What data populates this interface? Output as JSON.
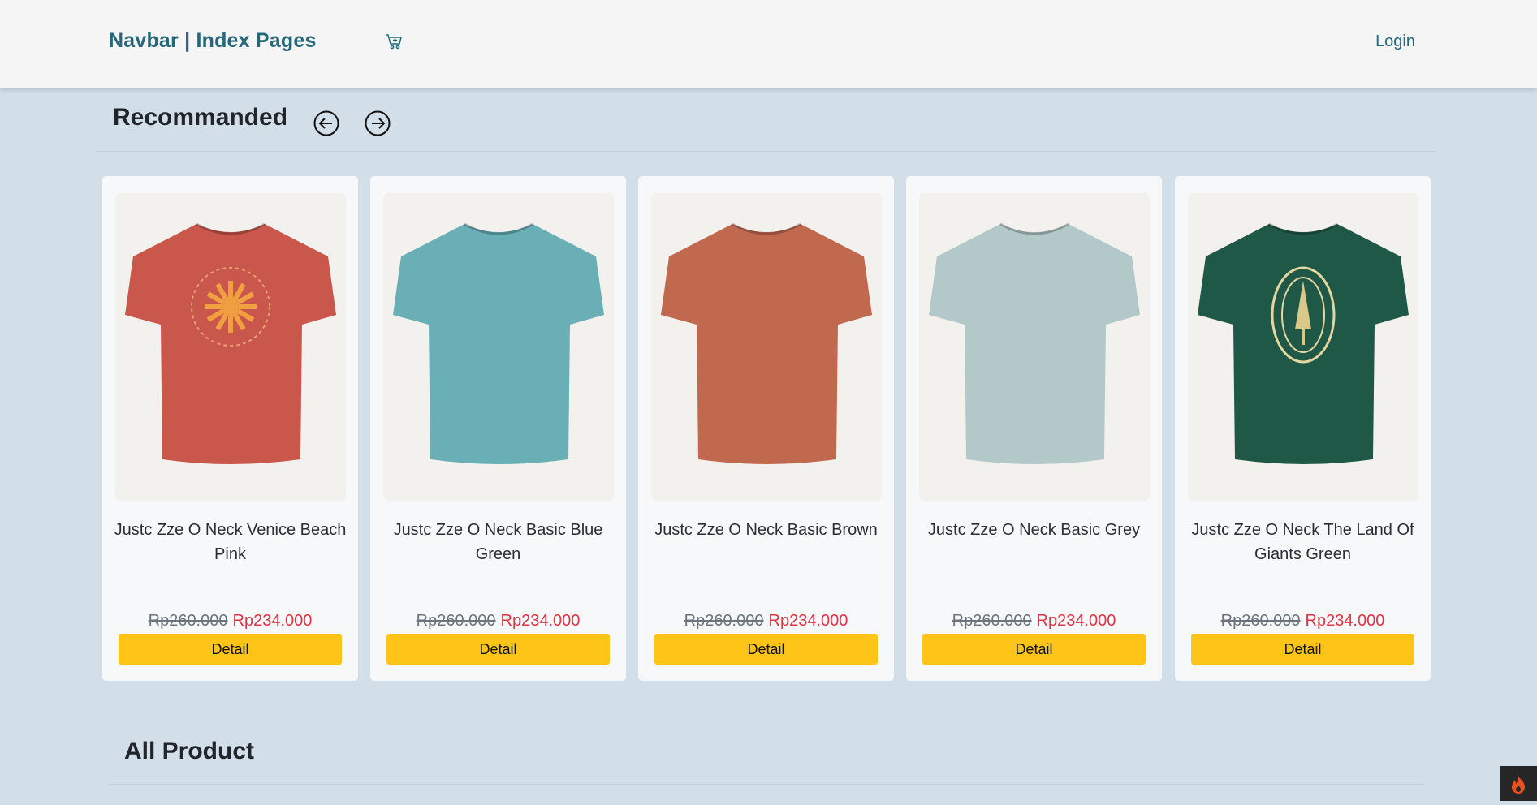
{
  "navbar": {
    "brand": "Navbar | Index Pages",
    "cart_icon": "cart-plus-icon",
    "login": "Login"
  },
  "recommended": {
    "title": "Recommanded",
    "prev_icon": "arrow-left-circle-icon",
    "next_icon": "arrow-right-circle-icon"
  },
  "products": [
    {
      "name": "Justc Zze O Neck Venice Beach Pink",
      "old_price": "Rp260.000",
      "price": "Rp234.000",
      "button": "Detail",
      "color": "#c9574b",
      "print": "sun"
    },
    {
      "name": "Justc Zze O Neck Basic Blue Green",
      "old_price": "Rp260.000",
      "price": "Rp234.000",
      "button": "Detail",
      "color": "#6aaeb6",
      "print": "none"
    },
    {
      "name": "Justc Zze O Neck Basic Brown",
      "old_price": "Rp260.000",
      "price": "Rp234.000",
      "button": "Detail",
      "color": "#c0694f",
      "print": "none"
    },
    {
      "name": "Justc Zze O Neck Basic Grey",
      "old_price": "Rp260.000",
      "price": "Rp234.000",
      "button": "Detail",
      "color": "#b3c8c8",
      "print": "none"
    },
    {
      "name": "Justc Zze O Neck The Land Of Giants Green",
      "old_price": "Rp260.000",
      "price": "Rp234.000",
      "button": "Detail",
      "color": "#1f5846",
      "print": "badge"
    }
  ],
  "all_products": {
    "title": "All Product"
  },
  "colors": {
    "brand": "#24687a",
    "button": "#ffc418",
    "sale": "#dc3545",
    "background": "#d3dfe8"
  },
  "corner_badge_icon": "flame-icon"
}
